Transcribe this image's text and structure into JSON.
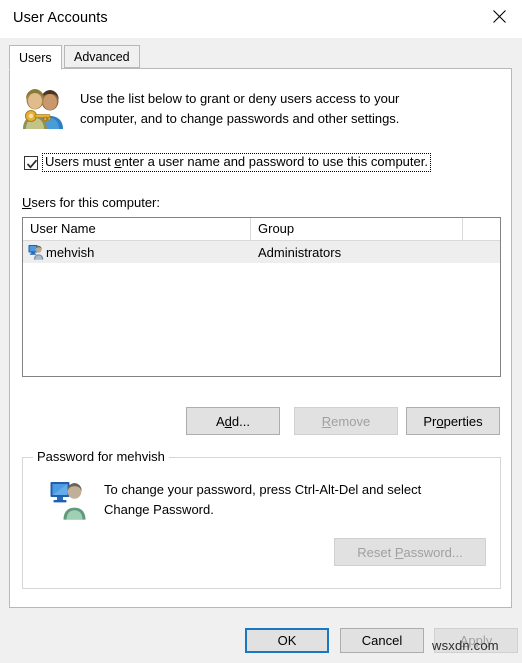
{
  "window": {
    "title": "User Accounts",
    "close_icon": "close-icon"
  },
  "tabs": [
    {
      "label": "Users",
      "active": true
    },
    {
      "label": "Advanced",
      "active": false
    }
  ],
  "description": {
    "icon": "users-key-icon",
    "line1": "Use the list below to grant or deny users access to your",
    "line2": "computer, and to change passwords and other settings."
  },
  "checkbox": {
    "checked": true,
    "label_before": "Users must ",
    "label_accel": "e",
    "label_after": "nter a user name and password to use this computer.",
    "full_label": "Users must enter a user name and password to use this computer."
  },
  "list": {
    "label_accel": "U",
    "label_rest": "sers for this computer:",
    "columns": [
      "User Name",
      "Group",
      ""
    ],
    "rows": [
      {
        "icon": "user-account-icon",
        "user_name": "mehvish",
        "group": "Administrators",
        "selected": true
      }
    ]
  },
  "mid_buttons": [
    {
      "name": "add-button",
      "before": "A",
      "accel": "d",
      "after": "d...",
      "full": "Add...",
      "disabled": false
    },
    {
      "name": "remove-button",
      "before": "",
      "accel": "R",
      "after": "emove",
      "full": "Remove",
      "disabled": true
    },
    {
      "name": "properties-button",
      "before": "Pr",
      "accel": "o",
      "after": "perties",
      "full": "Properties",
      "disabled": false
    }
  ],
  "password_group": {
    "title": "Password for mehvish",
    "icon": "user-monitor-icon",
    "line1": "To change your password, press Ctrl-Alt-Del and select",
    "line2": "Change Password.",
    "reset_button": {
      "before": "Reset ",
      "accel": "P",
      "after": "assword...",
      "full": "Reset Password...",
      "disabled": true
    }
  },
  "footer_buttons": [
    {
      "name": "ok-button",
      "before": "OK",
      "accel": "",
      "after": "",
      "full": "OK",
      "disabled": false,
      "default": true
    },
    {
      "name": "cancel-button",
      "before": "Cancel",
      "accel": "",
      "after": "",
      "full": "Cancel",
      "disabled": false,
      "default": false
    },
    {
      "name": "apply-button",
      "before": "",
      "accel": "A",
      "after": "pply",
      "full": "Apply",
      "disabled": true,
      "default": false
    }
  ],
  "watermark": "wsxdn.com",
  "colors": {
    "accent_blue": "#1a78c2",
    "dialog_bg": "#f0f0f0",
    "panel_bg": "#ffffff",
    "button_face": "#e1e1e1",
    "disabled_text": "#a0a0a0",
    "selection_row": "#eeeeee"
  }
}
